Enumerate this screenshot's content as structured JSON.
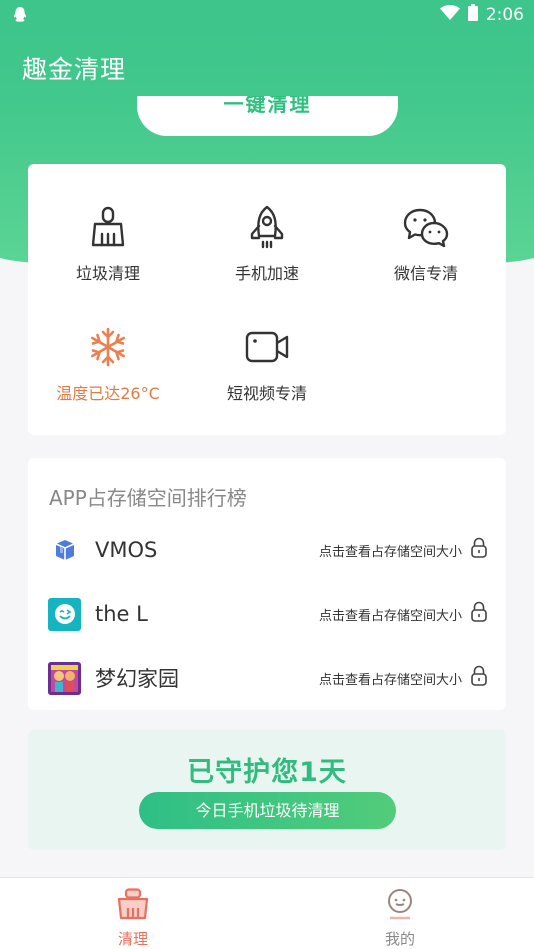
{
  "status_bar": {
    "time": "2:06"
  },
  "app_bar": {
    "title": "趣金清理"
  },
  "hero": {
    "clean_button_label": "一键清理"
  },
  "tools": [
    {
      "label": "垃圾清理",
      "icon": "broom-icon"
    },
    {
      "label": "手机加速",
      "icon": "rocket-icon"
    },
    {
      "label": "微信专清",
      "icon": "wechat-icon"
    },
    {
      "label": "温度已达26°C",
      "icon": "snowflake-icon"
    },
    {
      "label": "短视频专清",
      "icon": "video-camera-icon"
    }
  ],
  "ranking": {
    "title": "APP占存储空间排行榜",
    "rows": [
      {
        "app": "VMOS",
        "hint": "点击查看占存储空间大小"
      },
      {
        "app": "the L",
        "hint": "点击查看占存储空间大小"
      },
      {
        "app": "梦幻家园",
        "hint": "点击查看占存储空间大小"
      }
    ]
  },
  "guard": {
    "title": "已守护您1天",
    "button_label": "今日手机垃圾待清理"
  },
  "bottom_nav": [
    {
      "label": "清理",
      "icon": "clean-tab-icon",
      "active": true
    },
    {
      "label": "我的",
      "icon": "profile-tab-icon",
      "active": false
    }
  ],
  "colors": {
    "brand_green": "#3dc58b",
    "warning_orange": "#e37b46",
    "nav_active": "#e9705f",
    "nav_inactive": "#8a8a8a"
  }
}
